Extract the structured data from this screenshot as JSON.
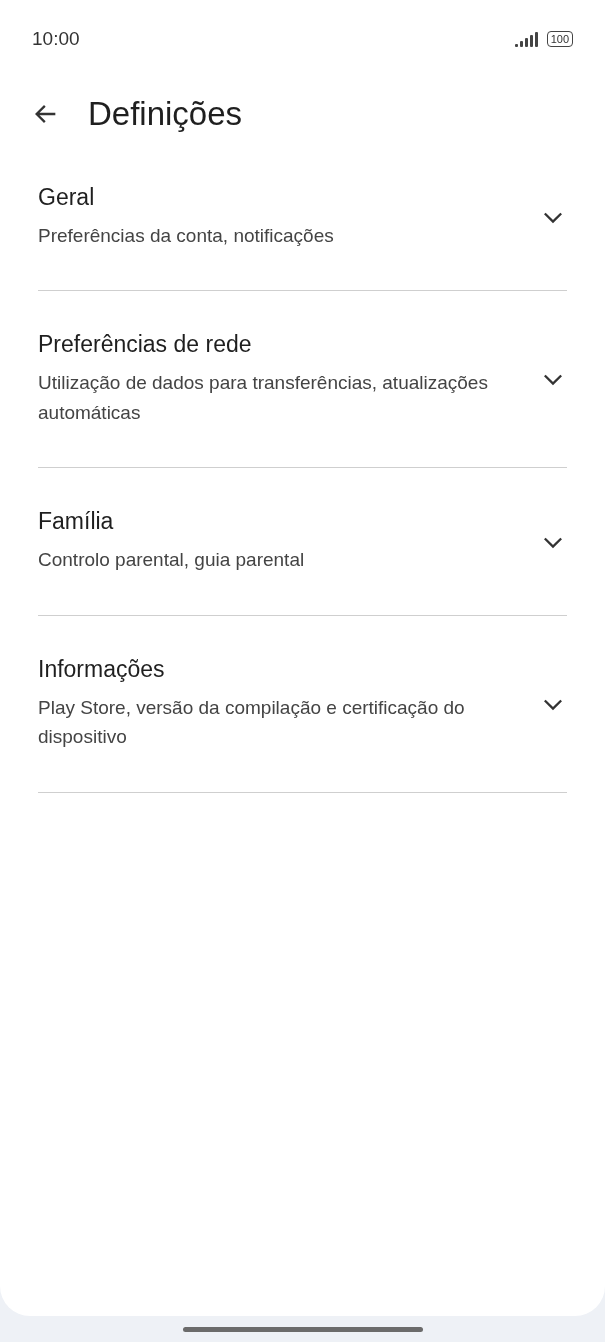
{
  "status_bar": {
    "time": "10:00",
    "battery": "100"
  },
  "header": {
    "title": "Definições"
  },
  "sections": [
    {
      "title": "Geral",
      "subtitle": "Preferências da conta, notificações",
      "expanded": false
    },
    {
      "title": "Preferências de rede",
      "subtitle": "Utilização de dados para transferências, atualizações automáticas",
      "expanded": false
    },
    {
      "title": "Família",
      "subtitle": "Controlo parental, guia parental",
      "expanded": false
    },
    {
      "title": "Informações",
      "subtitle": "Play Store, versão da compilação e certificação do dispositivo",
      "expanded": false
    }
  ]
}
